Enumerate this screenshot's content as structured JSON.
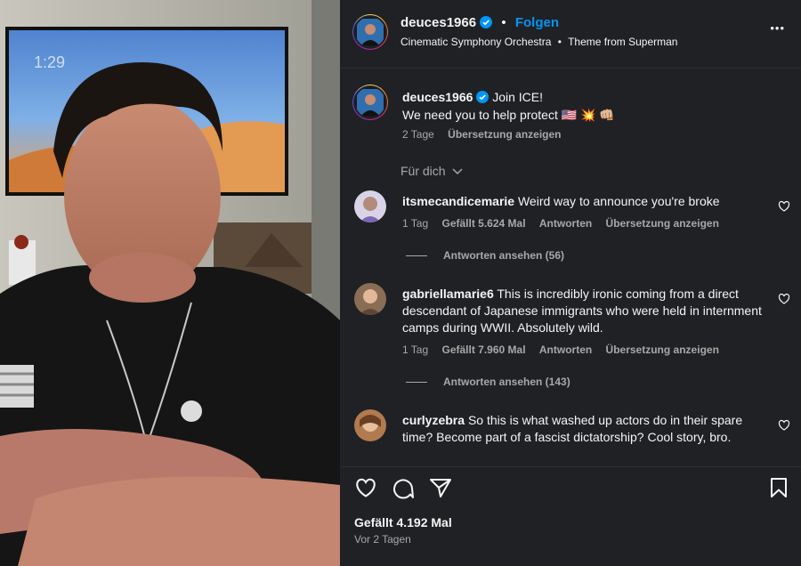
{
  "post": {
    "username": "deuces1966",
    "follow_label": "Folgen",
    "audio_artist": "Cinematic Symphony Orchestra",
    "audio_track": "Theme from Superman",
    "more_label": "•••"
  },
  "caption": {
    "username": "deuces1966",
    "line1": "Join ICE!",
    "line2": "We need you to help protect 🇺🇸 💥 👊🏼",
    "age": "2 Tage",
    "translate": "Übersetzung anzeigen"
  },
  "filter_label": "Für dich",
  "comments": [
    {
      "username": "itsmecandicemarie",
      "text": "Weird way to announce you're broke",
      "age": "1 Tag",
      "likes": "Gefällt 5.624 Mal",
      "reply": "Antworten",
      "translate": "Übersetzung anzeigen",
      "view_replies": "Antworten ansehen (56)"
    },
    {
      "username": "gabriellamarie6",
      "text": "This is incredibly ironic coming from a direct descendant of Japanese immigrants who were held in internment camps during WWII. Absolutely wild.",
      "age": "1 Tag",
      "likes": "Gefällt 7.960 Mal",
      "reply": "Antworten",
      "translate": "Übersetzung anzeigen",
      "view_replies": "Antworten ansehen (143)"
    },
    {
      "username": "curlyzebra",
      "text": "So this is what washed up actors do in their spare time? Become part of a fascist dictatorship? Cool story, bro."
    }
  ],
  "footer": {
    "likes": "Gefällt 4.192 Mal",
    "age": "Vor 2 Tagen"
  },
  "tv_clock": "1:29",
  "colors": {
    "verified": "#0095f6",
    "follow": "#0095f6",
    "panel_bg": "#202124"
  }
}
